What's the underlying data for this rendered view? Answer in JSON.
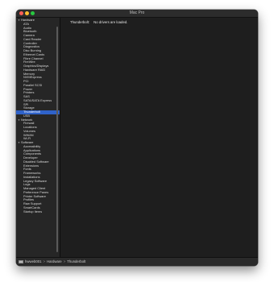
{
  "window": {
    "title": "Mac Pro"
  },
  "sidebar": {
    "sections": [
      {
        "label": "Hardware",
        "items": [
          "ATA",
          "Audio",
          "Bluetooth",
          "Camera",
          "Card Reader",
          "Controller",
          "Diagnostics",
          "Disc Burning",
          "Ethernet Cards",
          "Fibre Channel",
          "FireWire",
          "Graphics/Displays",
          "Hardware RAID",
          "Memory",
          "NVMExpress",
          "PCI",
          "Parallel SCSI",
          "Power",
          "Printers",
          "SAS",
          "SATA/SATA Express",
          "SPI",
          "Storage",
          "Thunderbolt",
          "USB"
        ]
      },
      {
        "label": "Network",
        "items": [
          "Firewall",
          "Locations",
          "Volumes",
          "WWAN",
          "Wi-Fi"
        ]
      },
      {
        "label": "Software",
        "items": [
          "Accessibility",
          "Applications",
          "Components",
          "Developer",
          "Disabled Software",
          "Extensions",
          "Fonts",
          "Frameworks",
          "Installations",
          "Legacy Software",
          "Logs",
          "Managed Client",
          "Preference Panes",
          "Printer Software",
          "Profiles",
          "Raw Support",
          "SmartCards",
          "Startup Items"
        ]
      }
    ],
    "selected": "Thunderbolt"
  },
  "main": {
    "label": "Thunderbolt:",
    "message": "No drivers are loaded."
  },
  "statusbar": {
    "computer_name": "hwweb001",
    "separator": ">",
    "path": [
      "Hardware",
      "Thunderbolt"
    ]
  }
}
